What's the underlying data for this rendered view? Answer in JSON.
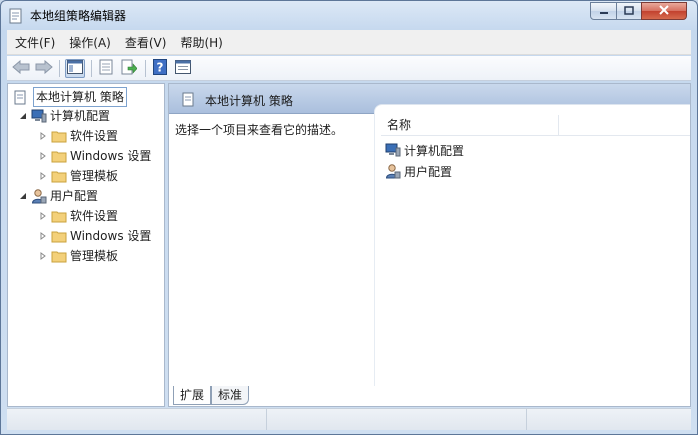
{
  "window": {
    "title": "本地组策略编辑器"
  },
  "menu": [
    "文件(F)",
    "操作(A)",
    "查看(V)",
    "帮助(H)"
  ],
  "toolbar": {
    "buttons": [
      "back-arrow-icon",
      "forward-arrow-icon",
      "show-hide-tree-icon",
      "properties-icon",
      "export-list-icon",
      "help-icon",
      "filter-icon"
    ]
  },
  "tree": {
    "root": "本地计算机 策略",
    "computer": {
      "label": "计算机配置",
      "children": [
        "软件设置",
        "Windows 设置",
        "管理模板"
      ]
    },
    "user": {
      "label": "用户配置",
      "children": [
        "软件设置",
        "Windows 设置",
        "管理模板"
      ]
    }
  },
  "details": {
    "header": "本地计算机 策略",
    "description": "选择一个项目来查看它的描述。",
    "column_name": "名称",
    "items": [
      "计算机配置",
      "用户配置"
    ]
  },
  "tabs": {
    "extended": "扩展",
    "standard": "标准"
  },
  "colors": {
    "accent": "#aabfdd",
    "folder": "#f3d07a"
  }
}
